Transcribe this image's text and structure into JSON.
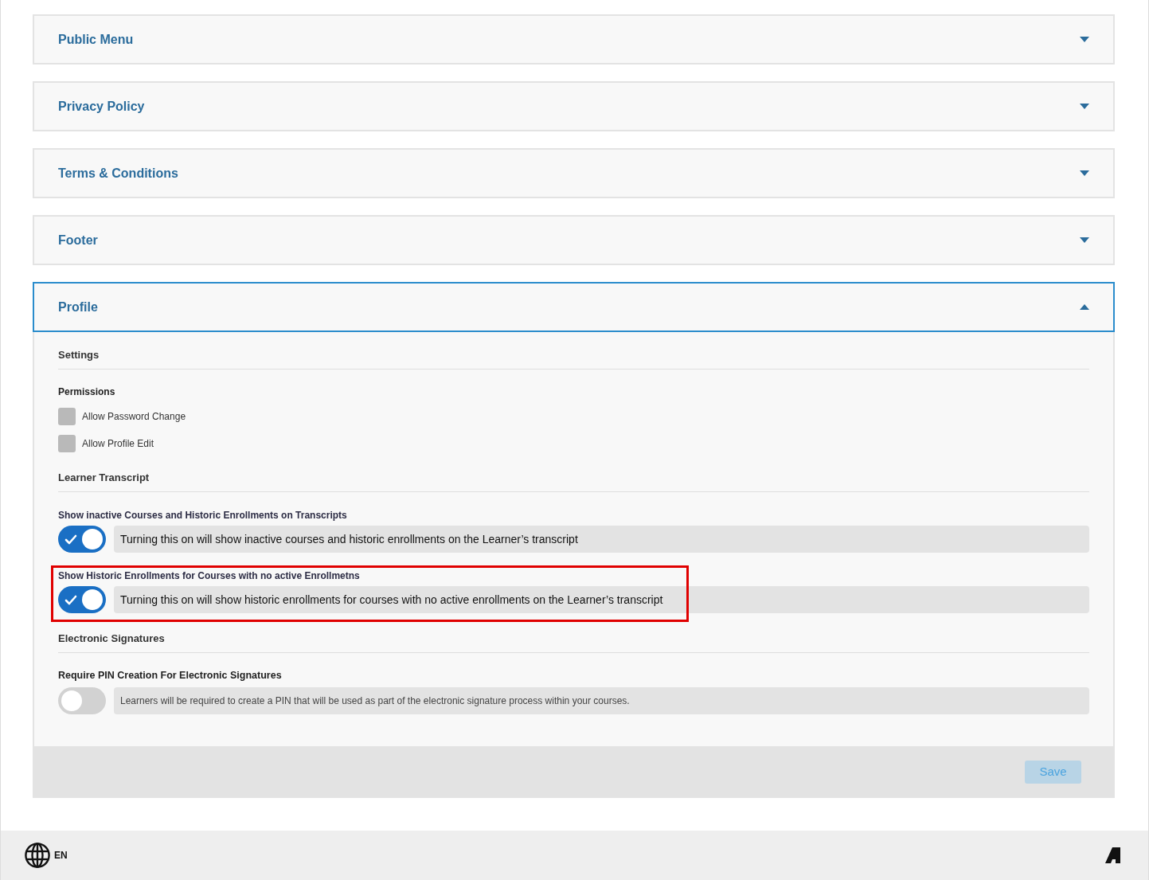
{
  "sections": [
    {
      "title": "Public Menu",
      "expanded": false
    },
    {
      "title": "Privacy Policy",
      "expanded": false
    },
    {
      "title": "Terms & Conditions",
      "expanded": false
    },
    {
      "title": "Footer",
      "expanded": false
    },
    {
      "title": "Profile",
      "expanded": true,
      "content": {
        "blocks": [
          {
            "kind": "heading",
            "text": "Settings"
          },
          {
            "kind": "subheading",
            "text": "Permissions"
          },
          {
            "kind": "checkbox",
            "label": "Allow Password Change",
            "checked": false
          },
          {
            "kind": "checkbox",
            "label": "Allow Profile Edit",
            "checked": false
          },
          {
            "kind": "heading",
            "text": "Learner Transcript"
          },
          {
            "kind": "toggle",
            "label": "Show inactive Courses and Historic Enrollments on Transcripts",
            "description": "Turning this on will show inactive courses and historic enrollments on the Learner’s transcript",
            "on": true,
            "highlighted": false
          },
          {
            "kind": "toggle",
            "label": "Show Historic Enrollments for Courses with no active Enrollmetns",
            "description": "Turning this on will show historic enrollments for courses with no active enrollments on the Learner’s transcript",
            "on": true,
            "highlighted": true
          },
          {
            "kind": "heading",
            "text": "Electronic Signatures"
          },
          {
            "kind": "toggle_compact",
            "label": "Require PIN Creation For Electronic Signatures",
            "description": "Learners will be required to create a PIN that will be used as part of the electronic signature process within your courses.",
            "on": false,
            "highlighted": false
          }
        ],
        "save_button": {
          "label": "Save",
          "disabled": true
        }
      }
    }
  ],
  "footer": {
    "language": "EN"
  }
}
